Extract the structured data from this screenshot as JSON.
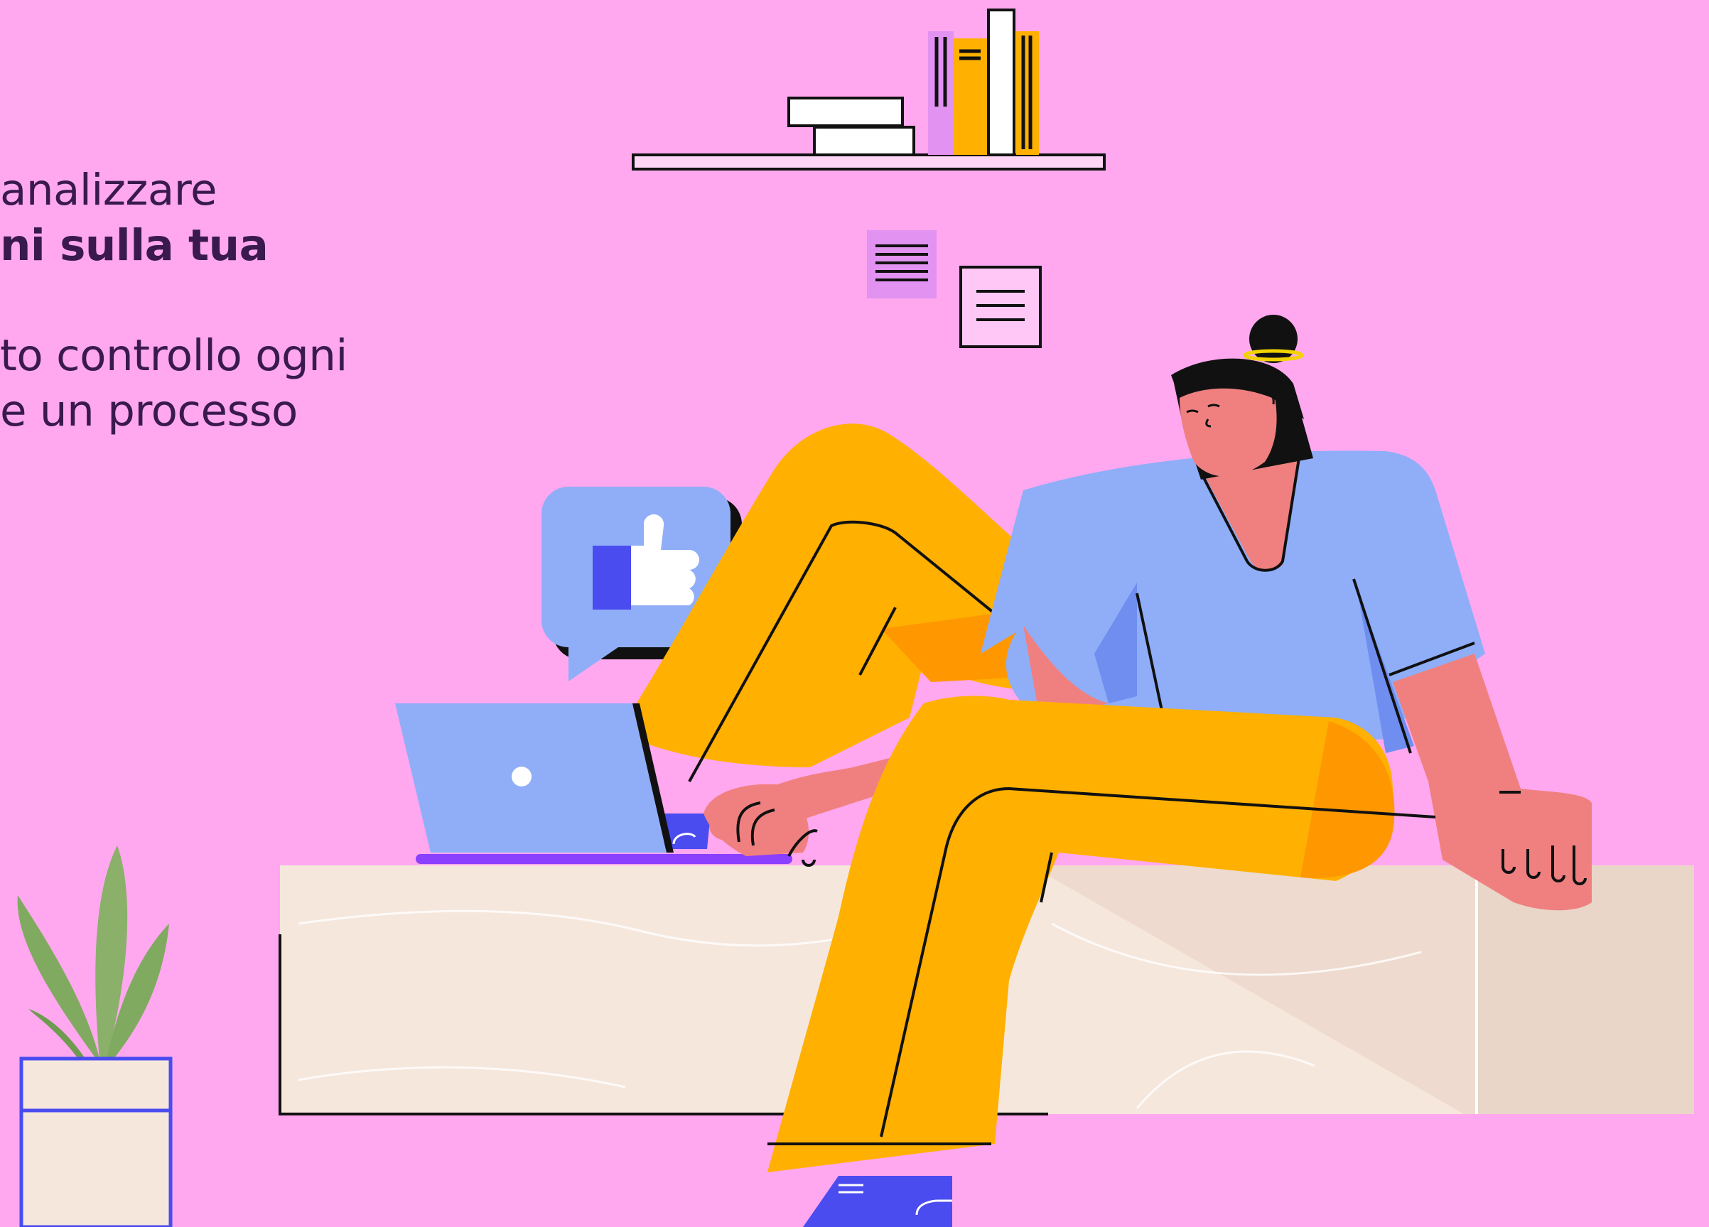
{
  "colors": {
    "background": "#FFA8EF",
    "text": "#3A1A4E",
    "yellow": "#FFB000",
    "blue": "#8FAEF7",
    "skin": "#F08080",
    "desk": "#F6E7DD"
  },
  "text": {
    "line1": "analizzare",
    "line2": "ni sulla tua",
    "line3": "to controllo ogni",
    "line4": "e un processo"
  },
  "icons": {
    "speech_bubble": "thumbs-up-icon",
    "notes": "document-icon"
  }
}
